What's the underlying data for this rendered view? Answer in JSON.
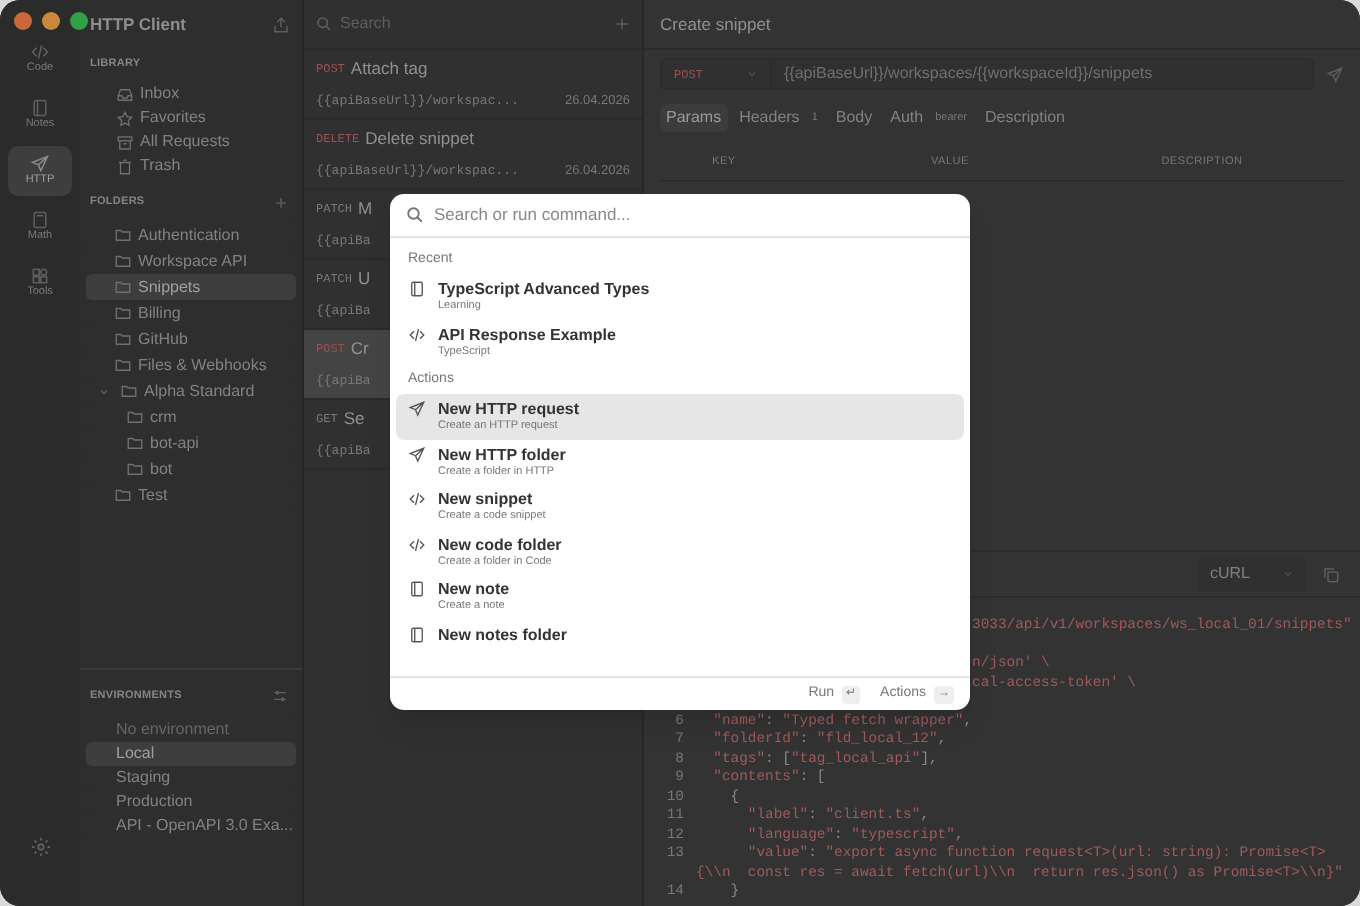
{
  "activity_bar": [
    {
      "label": "Code",
      "selected": false
    },
    {
      "label": "Notes",
      "selected": false
    },
    {
      "label": "HTTP",
      "selected": true
    },
    {
      "label": "Math",
      "selected": false
    },
    {
      "label": "Tools",
      "selected": false
    }
  ],
  "sidebar": {
    "title": "HTTP Client",
    "library": {
      "heading": "LIBRARY",
      "items": [
        {
          "label": "Inbox"
        },
        {
          "label": "Favorites"
        },
        {
          "label": "All Requests"
        },
        {
          "label": "Trash"
        }
      ]
    },
    "folders": {
      "heading": "FOLDERS",
      "items": [
        {
          "label": "Authentication",
          "selected": false
        },
        {
          "label": "Workspace API",
          "selected": false
        },
        {
          "label": "Snippets",
          "selected": true
        },
        {
          "label": "Billing",
          "selected": false
        },
        {
          "label": "GitHub",
          "selected": false
        },
        {
          "label": "Files & Webhooks",
          "selected": false
        },
        {
          "label": "Alpha Standard",
          "selected": false,
          "expanded": true,
          "children": [
            {
              "label": "crm",
              "selected": false
            },
            {
              "label": "bot-api",
              "selected": false
            },
            {
              "label": "bot",
              "selected": false
            }
          ]
        },
        {
          "label": "Test",
          "selected": false
        }
      ]
    },
    "environments": {
      "heading": "ENVIRONMENTS",
      "items": [
        {
          "label": "No environment",
          "selected": false,
          "disabled": true
        },
        {
          "label": "Local",
          "selected": true,
          "disabled": false
        },
        {
          "label": "Staging",
          "selected": false,
          "disabled": false
        },
        {
          "label": "Production",
          "selected": false,
          "disabled": false
        },
        {
          "label": "API - OpenAPI 3.0 Exa...",
          "selected": false,
          "disabled": false
        }
      ]
    }
  },
  "request_list": {
    "search": {
      "placeholder": "Search"
    },
    "items": [
      {
        "method": "POST",
        "name": "Attach tag",
        "url": "{{apiBaseUrl}}/workspac...",
        "date": "26.04.2026",
        "selected": false
      },
      {
        "method": "DELETE",
        "name": "Delete snippet",
        "url": "{{apiBaseUrl}}/workspac...",
        "date": "26.04.2026",
        "selected": false
      },
      {
        "method": "PATCH",
        "name": "M",
        "url": "{{apiBa",
        "selected": false
      },
      {
        "method": "PATCH",
        "name": "U",
        "url": "{{apiBa",
        "selected": false
      },
      {
        "method": "POST",
        "name": "Cr",
        "url": "{{apiBa",
        "selected": true
      },
      {
        "method": "GET",
        "name": "Se",
        "url": "{{apiBa",
        "selected": false
      }
    ]
  },
  "request": {
    "title": "Create snippet",
    "method": "POST",
    "url": "{{apiBaseUrl}}/workspaces/{{workspaceId}}/snippets",
    "tabs": [
      {
        "label": "Params",
        "selected": true
      },
      {
        "label": "Headers",
        "badge": "1",
        "selected": false
      },
      {
        "label": "Body",
        "selected": false
      },
      {
        "label": "Auth",
        "badge": "bearer",
        "selected": false
      },
      {
        "label": "Description",
        "selected": false
      }
    ],
    "columns": [
      "KEY",
      "VALUE",
      "DESCRIPTION"
    ],
    "code": {
      "language": "cURL",
      "lines": [
        {
          "kind": "tail",
          "text": "3033/api/v1/workspaces/ws_local_01/snippets\""
        },
        {
          "kind": "blank"
        },
        {
          "kind": "tail",
          "text": "n/json' \\"
        },
        {
          "kind": "tail",
          "text": "cal-access-token' \\"
        },
        {
          "kind": "blank"
        },
        {
          "kind": "line",
          "number": "6",
          "text": "  \"name\": \"Typed fetch wrapper\","
        },
        {
          "kind": "line",
          "number": "7",
          "text": "  \"folderId\": \"fld_local_12\","
        },
        {
          "kind": "line",
          "number": "8",
          "text": "  \"tags\": [\"tag_local_api\"],"
        },
        {
          "kind": "line",
          "number": "9",
          "text": "  \"contents\": ["
        },
        {
          "kind": "line",
          "number": "10",
          "text": "    {"
        },
        {
          "kind": "line",
          "number": "11",
          "text": "      \"label\": \"client.ts\","
        },
        {
          "kind": "line",
          "number": "12",
          "text": "      \"language\": \"typescript\","
        },
        {
          "kind": "line",
          "number": "13",
          "text": "      \"value\": \"export async function request<T>(url: string): Promise<T> {\\\\n  const res = await fetch(url)\\\\n  return res.json() as Promise<T>\\\\n}\""
        },
        {
          "kind": "line",
          "number": "14",
          "text": "    }"
        }
      ]
    }
  },
  "command_palette": {
    "placeholder": "Search or run command...",
    "sections": [
      {
        "heading": "Recent",
        "items": [
          {
            "kind": "note",
            "title": "TypeScript Advanced Types",
            "subtitle": "Learning",
            "selected": false
          },
          {
            "kind": "code",
            "title": "API Response Example",
            "subtitle": "TypeScript",
            "selected": false
          }
        ]
      },
      {
        "heading": "Actions",
        "items": [
          {
            "kind": "send",
            "title": "New HTTP request",
            "subtitle": "Create an HTTP request",
            "selected": true
          },
          {
            "kind": "send",
            "title": "New HTTP folder",
            "subtitle": "Create a folder in HTTP",
            "selected": false
          },
          {
            "kind": "code",
            "title": "New snippet",
            "subtitle": "Create a code snippet",
            "selected": false
          },
          {
            "kind": "code",
            "title": "New code folder",
            "subtitle": "Create a folder in Code",
            "selected": false
          },
          {
            "kind": "note",
            "title": "New note",
            "subtitle": "Create a note",
            "selected": false
          },
          {
            "kind": "note",
            "title": "New notes folder",
            "selected": false
          }
        ]
      }
    ],
    "footer": [
      {
        "label": "Run",
        "key": "↵"
      },
      {
        "label": "Actions",
        "key": "→"
      }
    ]
  }
}
